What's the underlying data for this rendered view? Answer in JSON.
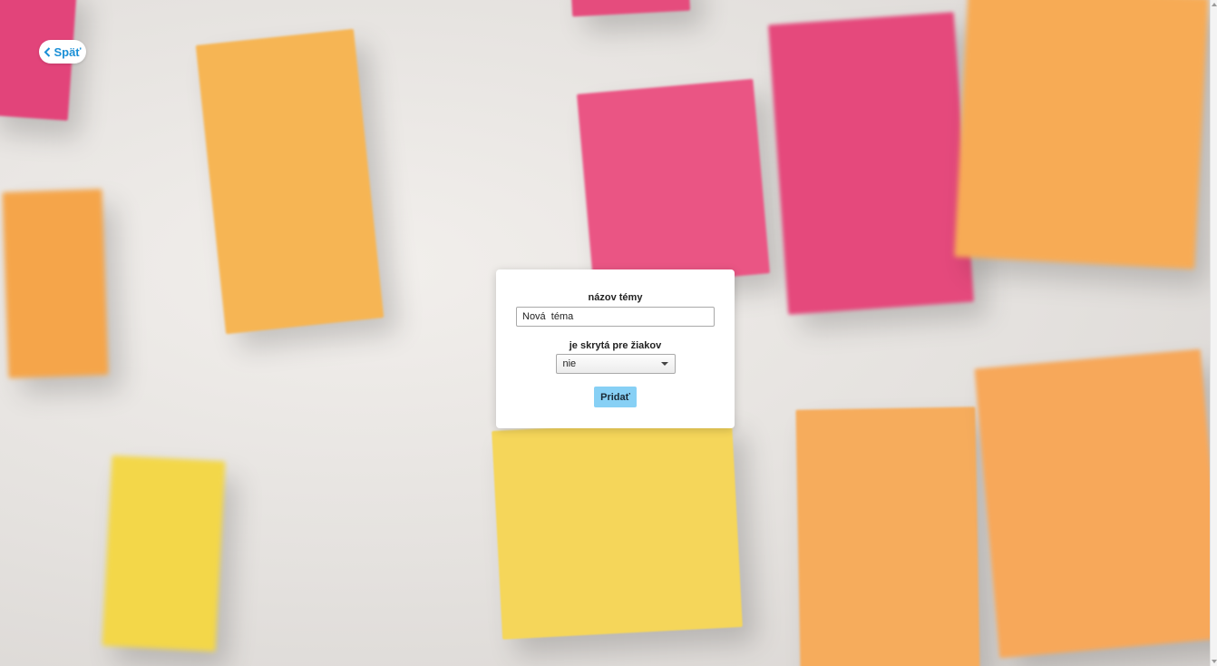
{
  "back_button": {
    "label": "Späť",
    "icon": "chevron-left-icon"
  },
  "form": {
    "title_label": "názov témy",
    "title_value": "Nová  téma",
    "hidden_label": "je skrytá pre žiakov",
    "hidden_selected": "nie",
    "submit_label": "Pridať"
  },
  "colors": {
    "accent": "#1a8fd6",
    "submit_button": "#87d0f5"
  }
}
